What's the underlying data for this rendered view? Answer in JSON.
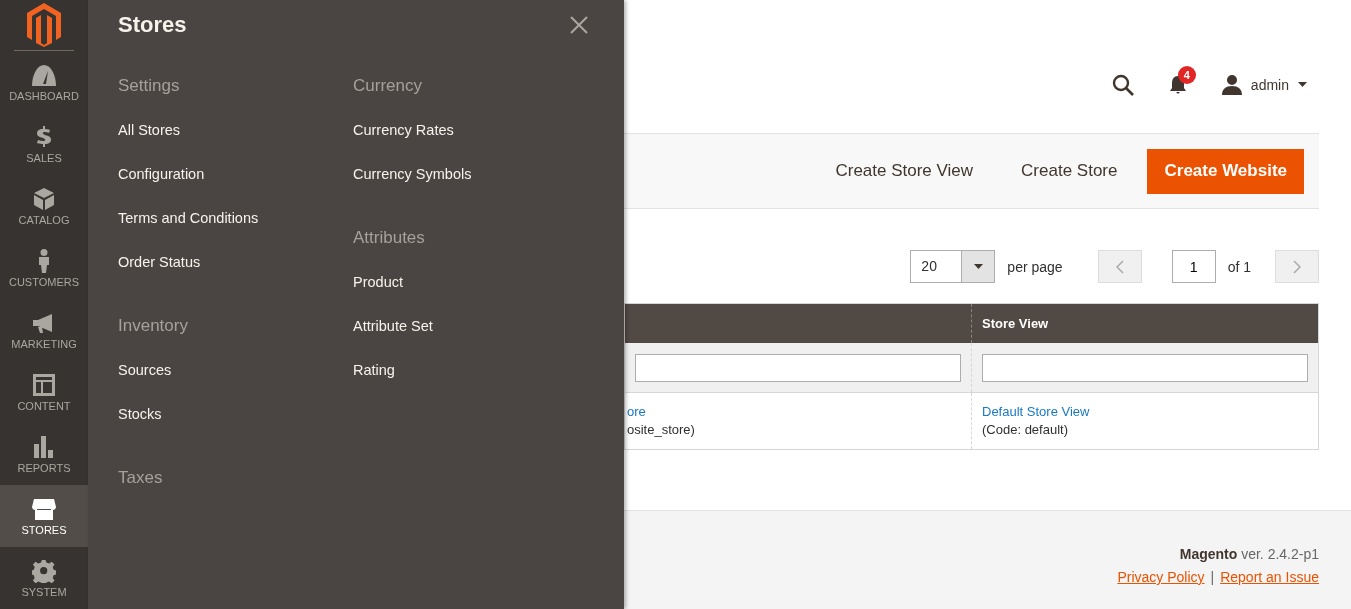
{
  "nav": [
    {
      "label": "DASHBOARD",
      "kind": "gauge",
      "selected": false
    },
    {
      "label": "SALES",
      "kind": "dollar",
      "selected": false
    },
    {
      "label": "CATALOG",
      "kind": "box",
      "selected": false
    },
    {
      "label": "CUSTOMERS",
      "kind": "person",
      "selected": false
    },
    {
      "label": "MARKETING",
      "kind": "megaphone",
      "selected": false
    },
    {
      "label": "CONTENT",
      "kind": "layout",
      "selected": false
    },
    {
      "label": "REPORTS",
      "kind": "bars",
      "selected": false
    },
    {
      "label": "STORES",
      "kind": "shop",
      "selected": true
    },
    {
      "label": "SYSTEM",
      "kind": "gear",
      "selected": false
    }
  ],
  "flyout": {
    "title": "Stores",
    "columns": [
      [
        {
          "heading": "Settings",
          "items": [
            "All Stores",
            "Configuration",
            "Terms and Conditions",
            "Order Status"
          ]
        },
        {
          "heading": "Inventory",
          "items": [
            "Sources",
            "Stocks"
          ]
        },
        {
          "heading": "Taxes"
        }
      ],
      [
        {
          "heading": "Currency",
          "items": [
            "Currency Rates",
            "Currency Symbols"
          ]
        },
        {
          "heading": "Attributes",
          "items": [
            "Product",
            "Attribute Set",
            "Rating"
          ]
        }
      ]
    ]
  },
  "header": {
    "notifications": "4",
    "user": "admin"
  },
  "actions": [
    {
      "label": "Create Store View",
      "kind": "secondary"
    },
    {
      "label": "Create Store",
      "kind": "secondary"
    },
    {
      "label": "Create Website",
      "kind": "primary"
    }
  ],
  "pager": {
    "per_page": "20",
    "per_page_label": "per page",
    "page": "1",
    "of": "of 1"
  },
  "table": {
    "columns": [
      "",
      "Store View"
    ],
    "rows": [
      [
        {
          "link": "ore",
          "note": "osite_store)"
        },
        {
          "link": "Default Store View",
          "note": "(Code: default)"
        }
      ]
    ]
  },
  "footer": {
    "version": "**Magento** ver. 2.4.2-p1",
    "links": [
      "Privacy Policy",
      "Report an Issue"
    ],
    "separator": "|"
  }
}
